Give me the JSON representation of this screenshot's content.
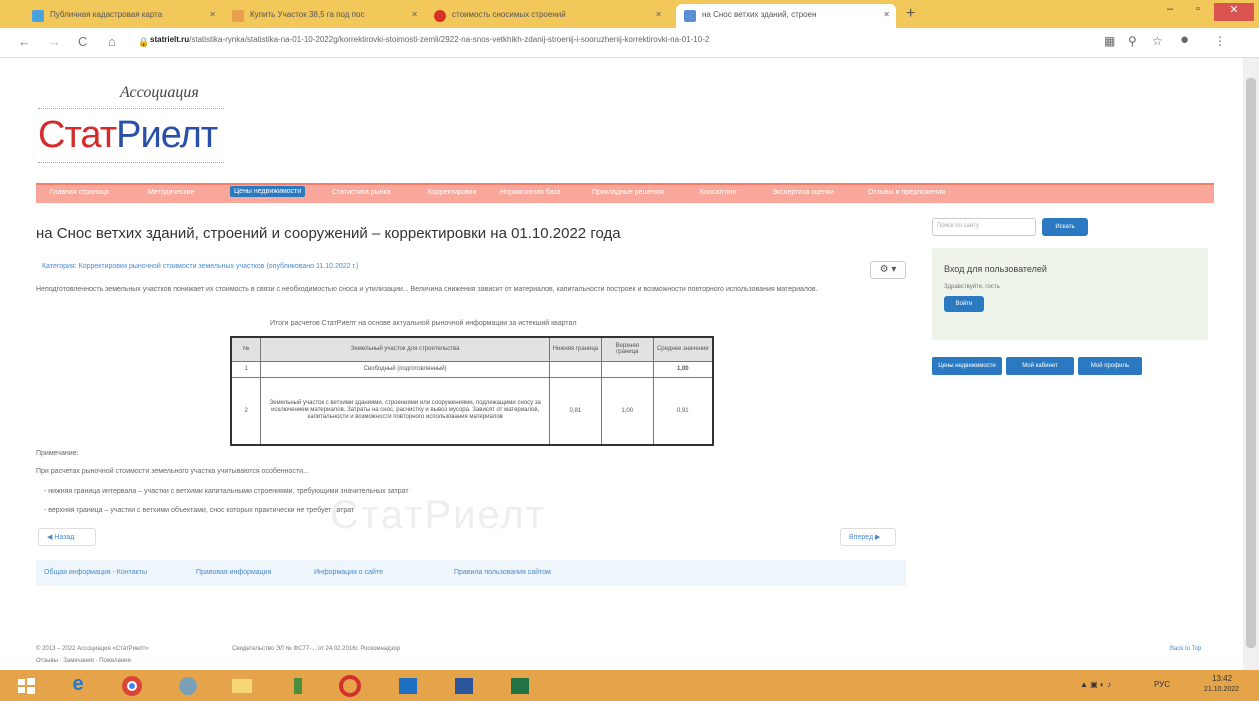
{
  "browser": {
    "tabs": [
      {
        "label": "Публичная кадастровая карта",
        "color": "#4aa3df"
      },
      {
        "label": "Купить Участок 38,5 га под пос",
        "color": "#e8a04c"
      },
      {
        "label": "стоимость сносимых строений",
        "color": "#d93025"
      },
      {
        "label": "на Снос ветхих зданий, строен",
        "color": "#5a8fd6"
      }
    ],
    "url_domain": "statrielt.ru",
    "url_path": "/statistika-rynka/statistika-na-01-10-2022g/korrektirovki-stoimosti-zemli/2922-na-snos-vetkhikh-zdanij-stroenij-i-sooruzhenij-korrektirovki-na-01-10-2",
    "nav_back": "←",
    "nav_forward": "→",
    "nav_reload": "C",
    "nav_home": "⌂",
    "minimize": "–",
    "maximize": "▫",
    "close": "✕",
    "new_tab": "+"
  },
  "site": {
    "assoc": "Ассоциация",
    "logo_red": "Стат",
    "logo_blue": "Риелт",
    "menu": [
      "Главная страница",
      "Методические",
      "Цены недвижимости",
      "Статистика рынка",
      "Корректировки",
      "Нормативная база",
      "Прикладные решения",
      "Консалтинг",
      "Экспертиза оценки",
      "Отзывы и предложения"
    ],
    "active_menu_index": 2
  },
  "main": {
    "title": "на Снос ветхих зданий, строений и сооружений – корректировки на 01.10.2022 года",
    "breadcrumb": "Категория: Корректировки рыночной стоимости земельных участков (опубликовано 11.10.2022 г.)",
    "gear": "⚙ ▾",
    "paragraph": "Неподготовленность земельных участков понижает их стоимость в связи с необходимостью сноса и утилизации... Величина снижения зависит от материалов, капитальности построек и возможности повторного использования материалов.",
    "caption": "Итоги расчетов СтатРиелт на основе актуальной рыночной информации за истекший квартал",
    "table": {
      "headers": [
        "№",
        "Земельный участок для строительства",
        "Нижняя граница",
        "Верхняя граница",
        "Среднее значение"
      ],
      "rows": [
        [
          "1",
          "Свободный (подготовленный)",
          "",
          "",
          "1,00"
        ],
        [
          "2",
          "Земельный участок с ветхими зданиями, строениями или сооружениями, подлежащими сносу за исключением материалов. Затраты на снос, расчистку и вывоз мусора. Зависят от материалов, капитальности и возможности повторного использования материалов",
          "0,81",
          "1,00",
          "0,91"
        ]
      ]
    },
    "note_title": "Примечание:",
    "note1": "При расчетах рыночной стоимости земельного участка учитываются особенности...",
    "note2": "- нижняя граница интервала – участки с ветхими капитальными строениями, требующими значительных затрат",
    "note3": "- верхняя граница – участки с ветхими объектами, снос которых практически не требует затрат",
    "watermark": "СтатРиелт",
    "prev": "◀ Назад",
    "next": "Вперед ▶",
    "links": [
      "Общая информация - Контакты",
      "Правовая информация",
      "Информация о сайте",
      "Правила пользования сайтом"
    ]
  },
  "sidebar": {
    "search_placeholder": "Поиск по сайту",
    "search_btn": "Искать",
    "login_title": "Вход для пользователей",
    "login_text": "Здравствуйте, гость",
    "login_btn": "Войти",
    "buttons": [
      "Цены недвижимости",
      "Мой кабинет",
      "Мой профиль"
    ]
  },
  "footer": {
    "copyright": "© 2013 – 2022 Ассоциация «СтатРиелт»",
    "links": "Отзывы · Замечания · Пожелания",
    "registration": "Свидетельство ЭЛ № ФС77-... от 24.02.2016г. Роскомнадзор",
    "back_to_top": "Back to Top"
  },
  "taskbar": {
    "lang": "РУС",
    "time": "13:42",
    "date": "21.10.2022"
  }
}
